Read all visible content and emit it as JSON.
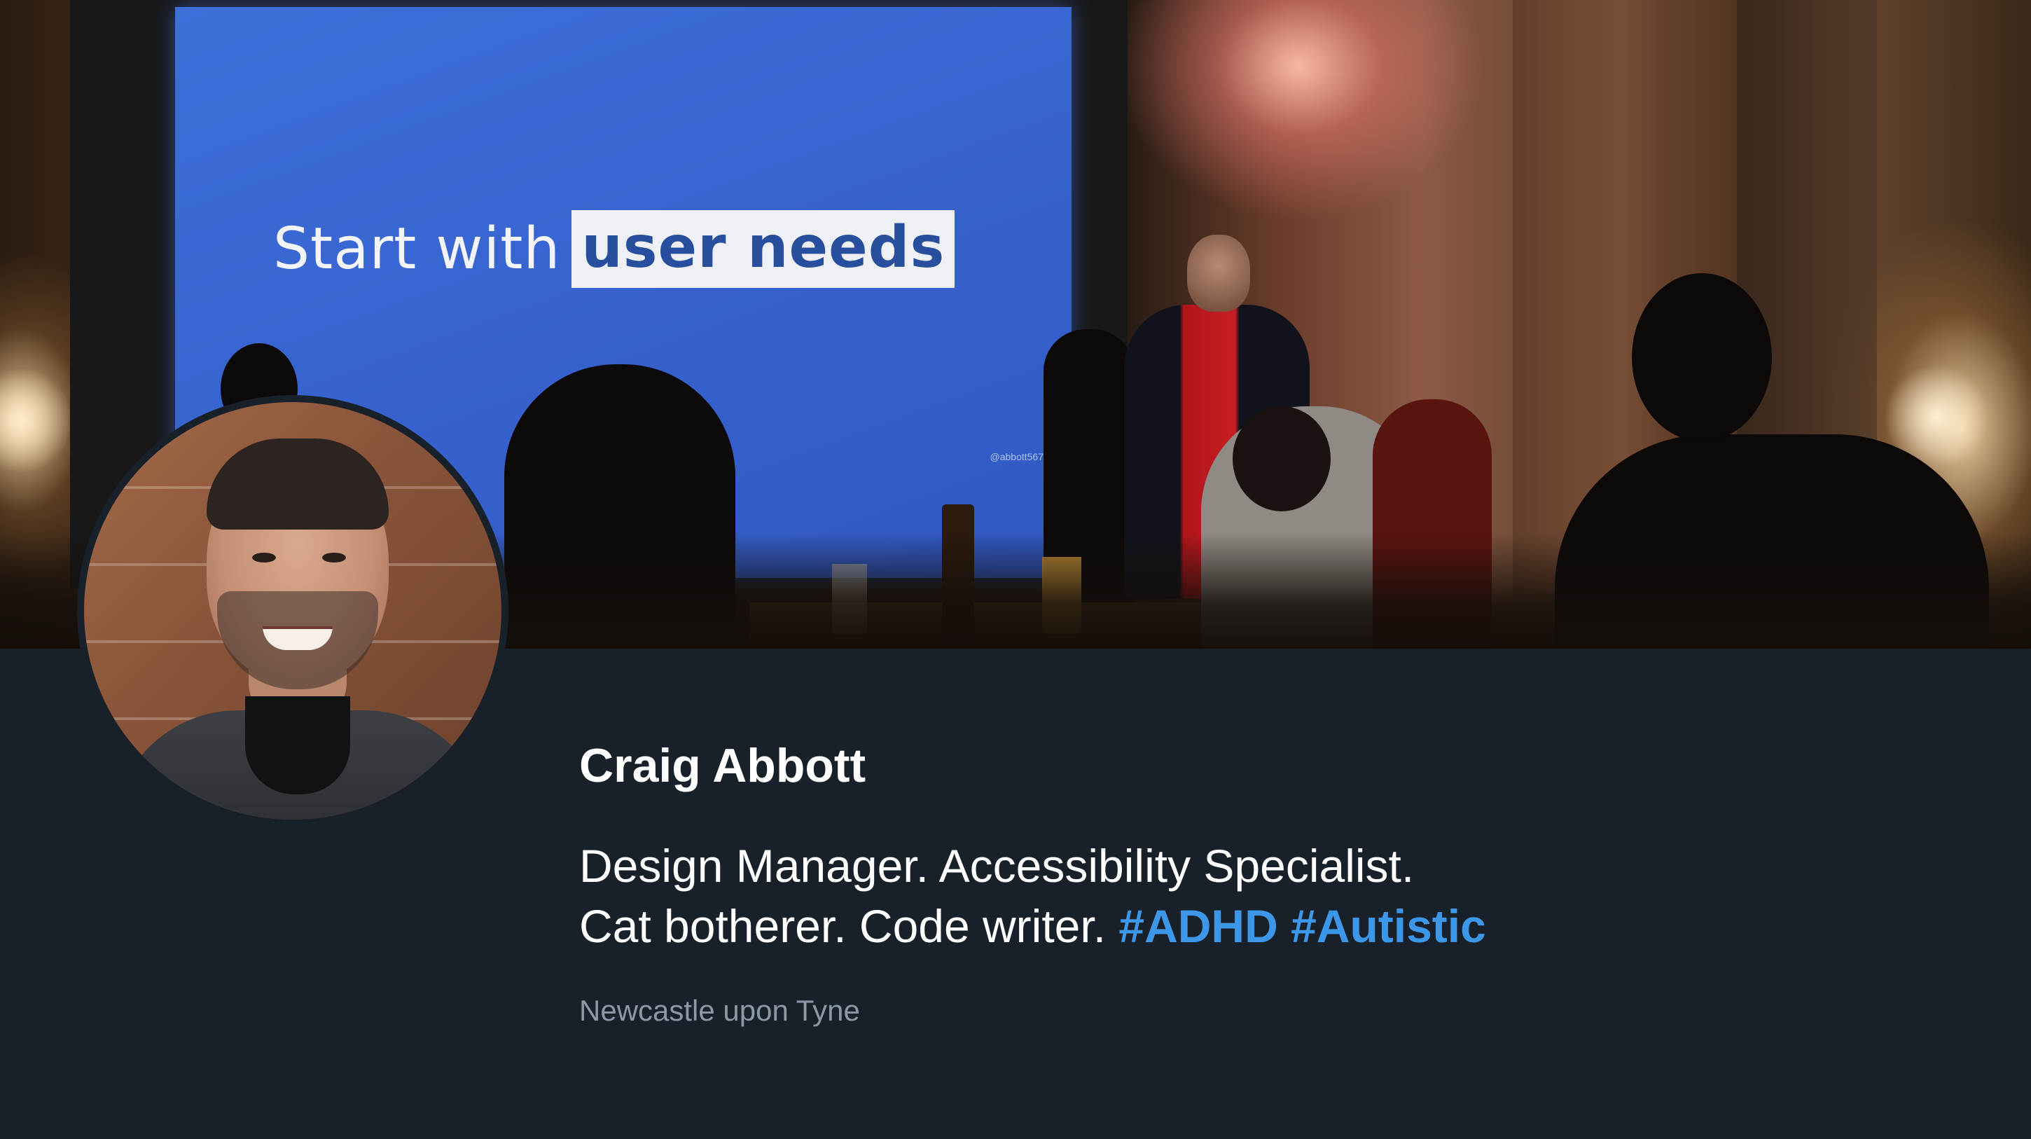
{
  "banner": {
    "slide_text_plain": "Start with",
    "slide_text_highlight": "user needs",
    "slide_handle": "@abbott567"
  },
  "profile": {
    "name": "Craig Abbott",
    "bio_line1": "Design Manager. Accessibility Specialist.",
    "bio_line2_text": "Cat botherer. Code writer.",
    "hashtags": [
      "#ADHD",
      "#Autistic"
    ],
    "location": "Newcastle upon Tyne"
  },
  "colors": {
    "background": "#18202a",
    "text": "#ffffff",
    "hashtag": "#3d97e8",
    "muted": "#8b98a5",
    "slide_blue": "#3864d0"
  },
  "icons": {
    "avatar": "profile-photo"
  }
}
